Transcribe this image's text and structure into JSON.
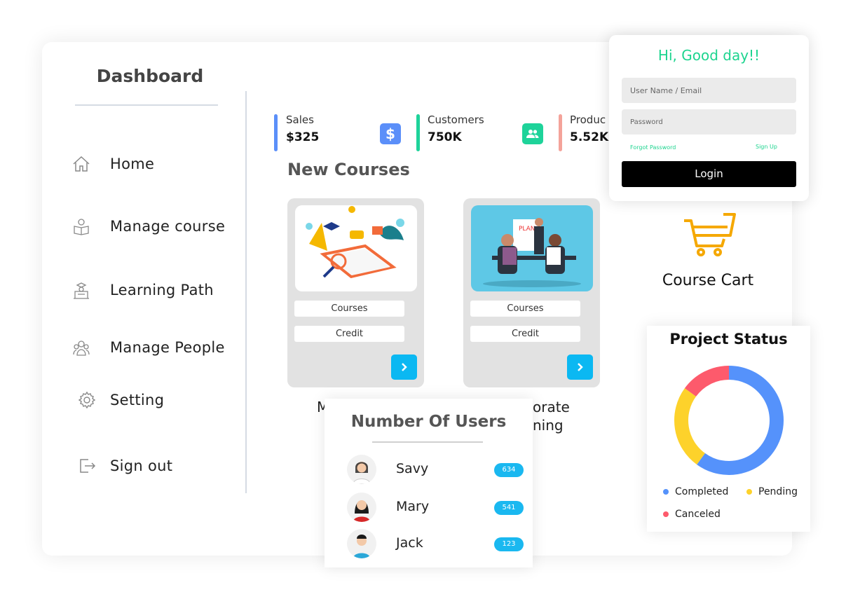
{
  "sidebar": {
    "title": "Dashboard",
    "items": [
      {
        "label": "Home",
        "icon": "home-icon"
      },
      {
        "label": "Manage course",
        "icon": "course-icon"
      },
      {
        "label": "Learning Path",
        "icon": "graduate-icon"
      },
      {
        "label": "Manage People",
        "icon": "people-icon"
      },
      {
        "label": "Setting",
        "icon": "gear-icon"
      },
      {
        "label": "Sign out",
        "icon": "sign-out-icon"
      }
    ]
  },
  "stats": [
    {
      "label": "Sales",
      "value": "$325",
      "color": "#5b8ff9",
      "icon": "dollar-icon"
    },
    {
      "label": "Customers",
      "value": "750K",
      "color": "#1ed39a",
      "icon": "users-icon"
    },
    {
      "label": "Produc",
      "value": "5.52K",
      "color": "#f4a39a"
    }
  ],
  "courses": {
    "title": "New Courses",
    "cards": [
      {
        "courses_label": "Courses",
        "credit_label": "Credit",
        "title_fragment": "M"
      },
      {
        "courses_label": "Courses",
        "credit_label": "Credit",
        "title_fragment_1": "orate",
        "title_fragment_2": "ning"
      }
    ]
  },
  "users": {
    "title": "Number Of Users",
    "rows": [
      {
        "name": "Savy",
        "count": "634"
      },
      {
        "name": "Mary",
        "count": "541"
      },
      {
        "name": "Jack",
        "count": "123"
      }
    ]
  },
  "login": {
    "greeting": "Hi, Good day!!",
    "username_placeholder": "User Name / Email",
    "password_placeholder": "Password",
    "forgot": "Forgot Password",
    "signup": "Sign Up",
    "button": "Login"
  },
  "cart": {
    "label": "Course Cart",
    "color": "#f5a800"
  },
  "chart_data": {
    "type": "pie",
    "title": "Project Status",
    "categories": [
      "Completed",
      "Pending",
      "Canceled"
    ],
    "values": [
      60,
      25,
      15
    ],
    "colors": [
      "#5592fb",
      "#fdd22b",
      "#fd5a6c"
    ],
    "donut": true,
    "legend": "bottom"
  }
}
